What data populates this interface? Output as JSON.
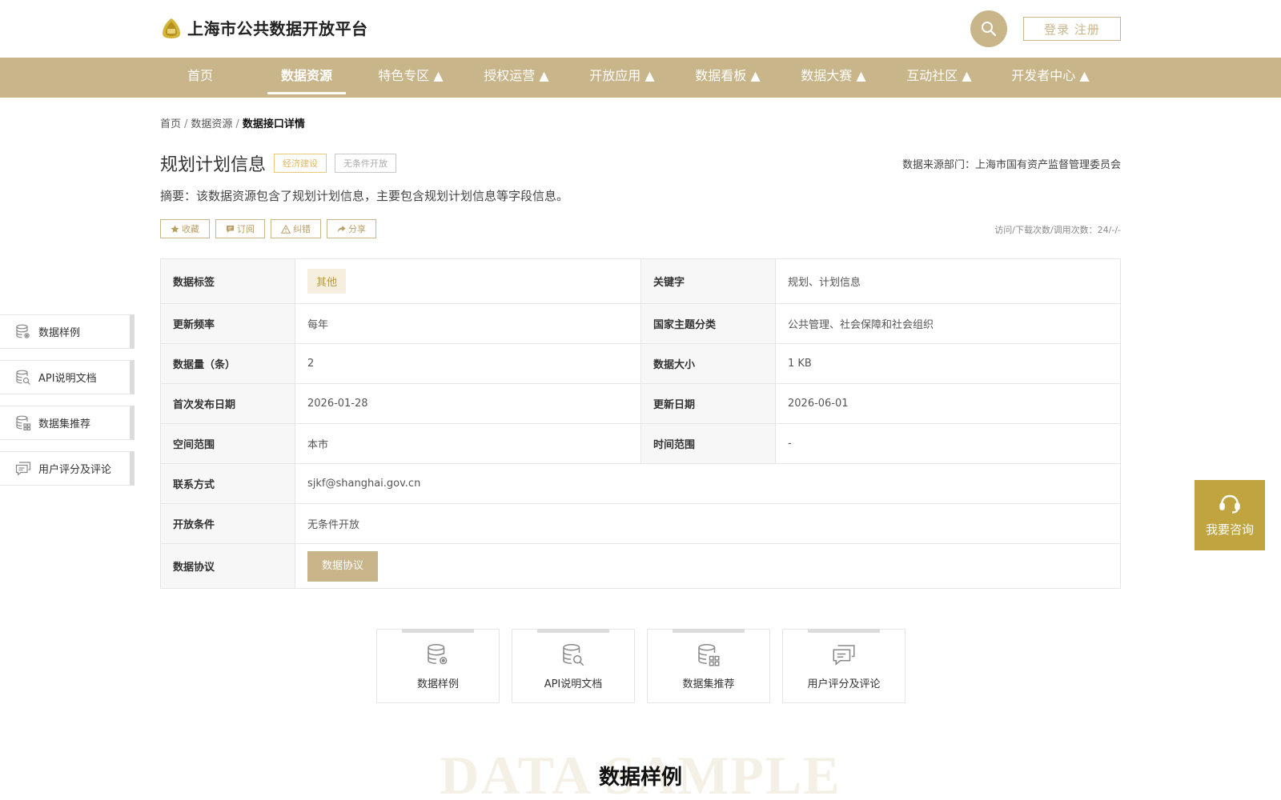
{
  "header": {
    "site_title": "上海市公共数据开放平台",
    "login_label": "登录 注册"
  },
  "nav": {
    "items": [
      {
        "label": "首页"
      },
      {
        "label": "数据资源"
      },
      {
        "label": "特色专区 ▲"
      },
      {
        "label": "授权运营 ▲"
      },
      {
        "label": "开放应用 ▲"
      },
      {
        "label": "数据看板 ▲"
      },
      {
        "label": "数据大赛 ▲"
      },
      {
        "label": "互动社区 ▲"
      },
      {
        "label": "开发者中心 ▲"
      }
    ]
  },
  "breadcrumb": {
    "items": [
      "首页",
      "数据资源"
    ],
    "current": "数据接口详情"
  },
  "detail": {
    "title": "规划计划信息",
    "tag_category": "经济建设",
    "tag_open": "无条件开放",
    "source_dept": "数据来源部门：上海市国有资产监督管理委员会",
    "summary": "摘要：该数据资源包含了规划计划信息，主要包含规划计划信息等字段信息。",
    "stats": "访问/下载次数/调用次数：24/-/-"
  },
  "actions": {
    "favorite": "收藏",
    "subscribe": "订阅",
    "report": "纠错",
    "share": "分享"
  },
  "info": {
    "tag_label": "数据标签",
    "tag_value": "其他",
    "keyword_label": "关键字",
    "keyword_value": "规划、计划信息",
    "freq_label": "更新频率",
    "freq_value": "每年",
    "theme_label": "国家主题分类",
    "theme_value": "公共管理、社会保障和社会组织",
    "count_label": "数据量（条）",
    "count_value": "2",
    "size_label": "数据大小",
    "size_value": "1 KB",
    "first_pub_label": "首次发布日期",
    "first_pub_value": "2026-01-28",
    "update_label": "更新日期",
    "update_value": "2026-06-01",
    "space_label": "空间范围",
    "space_value": "本市",
    "time_label": "时间范围",
    "time_value": "-",
    "contact_label": "联系方式",
    "contact_value": "sjkf@shanghai.gov.cn",
    "condition_label": "开放条件",
    "condition_value": "无条件开放",
    "agreement_label": "数据协议",
    "agreement_button": "数据协议"
  },
  "side_tabs": [
    {
      "label": "数据样例",
      "icon": "database-gear-icon"
    },
    {
      "label": "API说明文档",
      "icon": "database-search-icon"
    },
    {
      "label": "数据集推荐",
      "icon": "database-grid-icon"
    },
    {
      "label": "用户评分及评论",
      "icon": "comments-icon"
    }
  ],
  "cards": [
    {
      "label": "数据样例",
      "icon": "database-gear-icon"
    },
    {
      "label": "API说明文档",
      "icon": "database-search-icon"
    },
    {
      "label": "数据集推荐",
      "icon": "database-grid-icon"
    },
    {
      "label": "用户评分及评论",
      "icon": "comments-icon"
    }
  ],
  "consult": {
    "label": "我要咨询",
    "icon": "headset-icon"
  },
  "section": {
    "watermark": "DATA SAMPLE",
    "title": "数据样例"
  },
  "colors": {
    "brand": "#c9b58a",
    "consult_bg": "#c0a43f",
    "tag_econ": "#e0b760"
  }
}
